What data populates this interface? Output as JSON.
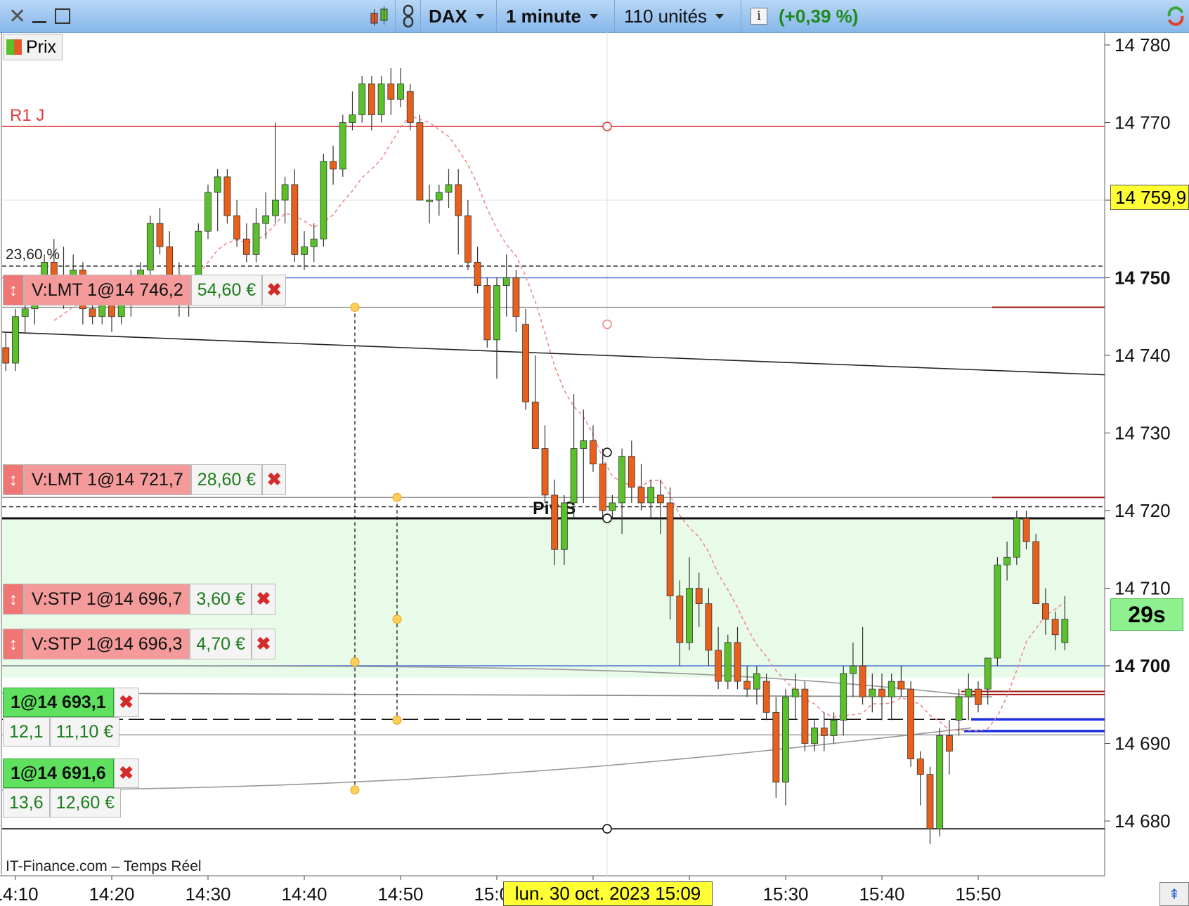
{
  "toolbar": {
    "instrument": "DAX",
    "interval": "1 minute",
    "units": "110 unités",
    "change": "(+0,39 %)",
    "colors": {
      "change": "#1f8a1f"
    }
  },
  "legend": {
    "label": "Prix"
  },
  "watermark": "IT-Finance.com – Temps Réel",
  "timer": "29s",
  "last_price_label": "14 759,9",
  "cursor_date": "lun. 30 oct. 2023 15:09",
  "orders": [
    {
      "label": "V:LMT  1@14 746,2",
      "pnl": "54,60 €"
    },
    {
      "label": "V:LMT  1@14 721,7",
      "pnl": "28,60 €"
    },
    {
      "label": "V:STP  1@14 696,7",
      "pnl": "3,60 €"
    },
    {
      "label": "V:STP  1@14 696,3",
      "pnl": "4,70 €"
    }
  ],
  "positions": [
    {
      "label": "1@14 693,1",
      "points": "12,1",
      "pnl": "11,10 €"
    },
    {
      "label": "1@14 691,6",
      "points": "13,6",
      "pnl": "12,60 €"
    }
  ],
  "chart_data": {
    "type": "candlestick",
    "y_ticks": [
      14680,
      14690,
      14700,
      14710,
      14720,
      14730,
      14740,
      14750,
      14760,
      14770,
      14780
    ],
    "y_tick_labels": [
      "14 680",
      "14 690",
      "14 700",
      "14 710",
      "14 720",
      "14 730",
      "14 740",
      "14 750",
      "14 760",
      "14 770",
      "14 780"
    ],
    "y_bold_ticks": [
      "14 750",
      "14 700"
    ],
    "ylim": [
      14673,
      14782
    ],
    "x_ticks": [
      "14:10",
      "14:20",
      "14:30",
      "14:40",
      "14:50",
      "15:00",
      "15:10",
      "15:20",
      "15:30",
      "15:40",
      "15:50"
    ],
    "levels": {
      "R1 J": 14769.5,
      "23,60 %": 14751.5,
      "38,20 %": 14720.5,
      "50,00 %": 14696.5,
      "Piv S": 14719,
      "S1 J": 14679
    },
    "candles": [
      {
        "t": "14:05",
        "o": 14743,
        "h": 14745,
        "l": 14738,
        "c": 14740
      },
      {
        "t": "14:06",
        "o": 14740,
        "h": 14742,
        "l": 14738,
        "c": 14741
      },
      {
        "t": "14:07",
        "o": 14741,
        "h": 14744,
        "l": 14739,
        "c": 14742
      },
      {
        "t": "14:08",
        "o": 14742,
        "h": 14745,
        "l": 14740,
        "c": 14741
      },
      {
        "t": "14:09",
        "o": 14741,
        "h": 14743,
        "l": 14738,
        "c": 14739
      },
      {
        "t": "14:10",
        "o": 14739,
        "h": 14746,
        "l": 14738,
        "c": 14745
      },
      {
        "t": "14:11",
        "o": 14745,
        "h": 14748,
        "l": 14743,
        "c": 14746
      },
      {
        "t": "14:12",
        "o": 14746,
        "h": 14750,
        "l": 14744,
        "c": 14749
      },
      {
        "t": "14:13",
        "o": 14749,
        "h": 14753,
        "l": 14747,
        "c": 14752
      },
      {
        "t": "14:14",
        "o": 14752,
        "h": 14755,
        "l": 14749,
        "c": 14750
      },
      {
        "t": "14:15",
        "o": 14750,
        "h": 14754,
        "l": 14746,
        "c": 14748
      },
      {
        "t": "14:16",
        "o": 14748,
        "h": 14753,
        "l": 14747,
        "c": 14751
      },
      {
        "t": "14:17",
        "o": 14751,
        "h": 14752,
        "l": 14744,
        "c": 14746
      },
      {
        "t": "14:18",
        "o": 14746,
        "h": 14748,
        "l": 14744,
        "c": 14745
      },
      {
        "t": "14:19",
        "o": 14745,
        "h": 14748,
        "l": 14744,
        "c": 14747
      },
      {
        "t": "14:20",
        "o": 14747,
        "h": 14749,
        "l": 14743,
        "c": 14745
      },
      {
        "t": "14:21",
        "o": 14745,
        "h": 14748,
        "l": 14744,
        "c": 14747
      },
      {
        "t": "14:22",
        "o": 14747,
        "h": 14751,
        "l": 14745,
        "c": 14749
      },
      {
        "t": "14:23",
        "o": 14749,
        "h": 14752,
        "l": 14747,
        "c": 14751
      },
      {
        "t": "14:24",
        "o": 14751,
        "h": 14758,
        "l": 14750,
        "c": 14757
      },
      {
        "t": "14:25",
        "o": 14757,
        "h": 14759,
        "l": 14753,
        "c": 14754
      },
      {
        "t": "14:26",
        "o": 14754,
        "h": 14756,
        "l": 14749,
        "c": 14750
      },
      {
        "t": "14:27",
        "o": 14750,
        "h": 14752,
        "l": 14745,
        "c": 14747
      },
      {
        "t": "14:28",
        "o": 14747,
        "h": 14749,
        "l": 14745,
        "c": 14748
      },
      {
        "t": "14:29",
        "o": 14748,
        "h": 14757,
        "l": 14747,
        "c": 14756
      },
      {
        "t": "14:30",
        "o": 14756,
        "h": 14762,
        "l": 14755,
        "c": 14761
      },
      {
        "t": "14:31",
        "o": 14761,
        "h": 14764,
        "l": 14756,
        "c": 14763
      },
      {
        "t": "14:32",
        "o": 14763,
        "h": 14764,
        "l": 14757,
        "c": 14758
      },
      {
        "t": "14:33",
        "o": 14758,
        "h": 14760,
        "l": 14754,
        "c": 14755
      },
      {
        "t": "14:34",
        "o": 14755,
        "h": 14757,
        "l": 14752,
        "c": 14753
      },
      {
        "t": "14:35",
        "o": 14753,
        "h": 14759,
        "l": 14752,
        "c": 14757
      },
      {
        "t": "14:36",
        "o": 14757,
        "h": 14761,
        "l": 14755,
        "c": 14758
      },
      {
        "t": "14:37",
        "o": 14758,
        "h": 14770,
        "l": 14757,
        "c": 14760
      },
      {
        "t": "14:38",
        "o": 14760,
        "h": 14763,
        "l": 14757,
        "c": 14762
      },
      {
        "t": "14:39",
        "o": 14762,
        "h": 14764,
        "l": 14752,
        "c": 14753
      },
      {
        "t": "14:40",
        "o": 14753,
        "h": 14756,
        "l": 14751,
        "c": 14754
      },
      {
        "t": "14:41",
        "o": 14754,
        "h": 14757,
        "l": 14752,
        "c": 14755
      },
      {
        "t": "14:42",
        "o": 14755,
        "h": 14766,
        "l": 14754,
        "c": 14765
      },
      {
        "t": "14:43",
        "o": 14765,
        "h": 14767,
        "l": 14762,
        "c": 14764
      },
      {
        "t": "14:44",
        "o": 14764,
        "h": 14771,
        "l": 14763,
        "c": 14770
      },
      {
        "t": "14:45",
        "o": 14770,
        "h": 14774,
        "l": 14769,
        "c": 14771
      },
      {
        "t": "14:46",
        "o": 14771,
        "h": 14776,
        "l": 14770,
        "c": 14775
      },
      {
        "t": "14:47",
        "o": 14775,
        "h": 14776,
        "l": 14769,
        "c": 14771
      },
      {
        "t": "14:48",
        "o": 14771,
        "h": 14776,
        "l": 14770,
        "c": 14775
      },
      {
        "t": "14:49",
        "o": 14775,
        "h": 14777,
        "l": 14771,
        "c": 14773
      },
      {
        "t": "14:50",
        "o": 14773,
        "h": 14777,
        "l": 14772,
        "c": 14775
      },
      {
        "t": "14:51",
        "o": 14774,
        "h": 14775,
        "l": 14769,
        "c": 14770
      },
      {
        "t": "14:52",
        "o": 14770,
        "h": 14771,
        "l": 14760,
        "c": 14760
      },
      {
        "t": "14:53",
        "o": 14760,
        "h": 14762,
        "l": 14757,
        "c": 14760
      },
      {
        "t": "14:54",
        "o": 14760,
        "h": 14762,
        "l": 14758,
        "c": 14761
      },
      {
        "t": "14:55",
        "o": 14761,
        "h": 14764,
        "l": 14759,
        "c": 14762
      },
      {
        "t": "14:56",
        "o": 14762,
        "h": 14764,
        "l": 14753,
        "c": 14758
      },
      {
        "t": "14:57",
        "o": 14758,
        "h": 14760,
        "l": 14751,
        "c": 14752
      },
      {
        "t": "14:58",
        "o": 14752,
        "h": 14754,
        "l": 14748,
        "c": 14749
      },
      {
        "t": "14:59",
        "o": 14749,
        "h": 14750,
        "l": 14741,
        "c": 14742
      },
      {
        "t": "15:00",
        "o": 14742,
        "h": 14750,
        "l": 14737,
        "c": 14749
      },
      {
        "t": "15:01",
        "o": 14749,
        "h": 14753,
        "l": 14745,
        "c": 14750
      },
      {
        "t": "15:02",
        "o": 14750,
        "h": 14751,
        "l": 14743,
        "c": 14745
      },
      {
        "t": "15:03",
        "o": 14744,
        "h": 14746,
        "l": 14733,
        "c": 14734
      },
      {
        "t": "15:04",
        "o": 14734,
        "h": 14740,
        "l": 14729,
        "c": 14728
      },
      {
        "t": "15:05",
        "o": 14728,
        "h": 14731,
        "l": 14721,
        "c": 14722
      },
      {
        "t": "15:06",
        "o": 14722,
        "h": 14724,
        "l": 14713,
        "c": 14715
      },
      {
        "t": "15:07",
        "o": 14715,
        "h": 14722,
        "l": 14713,
        "c": 14721
      },
      {
        "t": "15:08",
        "o": 14721,
        "h": 14735,
        "l": 14719,
        "c": 14728
      },
      {
        "t": "15:09",
        "o": 14728,
        "h": 14733,
        "l": 14721,
        "c": 14729
      },
      {
        "t": "15:10",
        "o": 14729,
        "h": 14731,
        "l": 14725,
        "c": 14726
      },
      {
        "t": "15:11",
        "o": 14726,
        "h": 14728,
        "l": 14719,
        "c": 14720
      },
      {
        "t": "15:12",
        "o": 14720,
        "h": 14722,
        "l": 14719,
        "c": 14721
      },
      {
        "t": "15:13",
        "o": 14721,
        "h": 14728,
        "l": 14717,
        "c": 14727
      },
      {
        "t": "15:14",
        "o": 14727,
        "h": 14729,
        "l": 14721,
        "c": 14723
      },
      {
        "t": "15:15",
        "o": 14723,
        "h": 14726,
        "l": 14720,
        "c": 14721
      },
      {
        "t": "15:16",
        "o": 14721,
        "h": 14724,
        "l": 14719,
        "c": 14723
      },
      {
        "t": "15:17",
        "o": 14722,
        "h": 14724,
        "l": 14717,
        "c": 14721
      },
      {
        "t": "15:18",
        "o": 14721,
        "h": 14723,
        "l": 14706,
        "c": 14709
      },
      {
        "t": "15:19",
        "o": 14709,
        "h": 14711,
        "l": 14700,
        "c": 14703
      },
      {
        "t": "15:20",
        "o": 14703,
        "h": 14714,
        "l": 14702,
        "c": 14710
      },
      {
        "t": "15:21",
        "o": 14710,
        "h": 14712,
        "l": 14705,
        "c": 14708
      },
      {
        "t": "15:22",
        "o": 14708,
        "h": 14710,
        "l": 14700,
        "c": 14702
      },
      {
        "t": "15:23",
        "o": 14702,
        "h": 14705,
        "l": 14697,
        "c": 14698
      },
      {
        "t": "15:24",
        "o": 14698,
        "h": 14704,
        "l": 14697,
        "c": 14703
      },
      {
        "t": "15:25",
        "o": 14703,
        "h": 14705,
        "l": 14697,
        "c": 14698
      },
      {
        "t": "15:26",
        "o": 14698,
        "h": 14700,
        "l": 14696,
        "c": 14697
      },
      {
        "t": "15:27",
        "o": 14697,
        "h": 14700,
        "l": 14695,
        "c": 14699
      },
      {
        "t": "15:28",
        "o": 14698,
        "h": 14699,
        "l": 14693,
        "c": 14694
      },
      {
        "t": "15:29",
        "o": 14694,
        "h": 14696,
        "l": 14683,
        "c": 14685
      },
      {
        "t": "15:30",
        "o": 14685,
        "h": 14697,
        "l": 14682,
        "c": 14696
      },
      {
        "t": "15:31",
        "o": 14696,
        "h": 14699,
        "l": 14693,
        "c": 14697
      },
      {
        "t": "15:32",
        "o": 14697,
        "h": 14698,
        "l": 14689,
        "c": 14690
      },
      {
        "t": "15:33",
        "o": 14690,
        "h": 14693,
        "l": 14689,
        "c": 14692
      },
      {
        "t": "15:34",
        "o": 14692,
        "h": 14694,
        "l": 14689,
        "c": 14691
      },
      {
        "t": "15:35",
        "o": 14691,
        "h": 14694,
        "l": 14690,
        "c": 14693
      },
      {
        "t": "15:36",
        "o": 14693,
        "h": 14700,
        "l": 14691,
        "c": 14699
      },
      {
        "t": "15:37",
        "o": 14699,
        "h": 14703,
        "l": 14696,
        "c": 14700
      },
      {
        "t": "15:38",
        "o": 14700,
        "h": 14705,
        "l": 14695,
        "c": 14696
      },
      {
        "t": "15:39",
        "o": 14696,
        "h": 14699,
        "l": 14694,
        "c": 14697
      },
      {
        "t": "15:40",
        "o": 14697,
        "h": 14699,
        "l": 14693,
        "c": 14696
      },
      {
        "t": "15:41",
        "o": 14696,
        "h": 14699,
        "l": 14693,
        "c": 14698
      },
      {
        "t": "15:42",
        "o": 14698,
        "h": 14700,
        "l": 14696,
        "c": 14697
      },
      {
        "t": "15:43",
        "o": 14697,
        "h": 14698,
        "l": 14687,
        "c": 14688
      },
      {
        "t": "15:44",
        "o": 14688,
        "h": 14689,
        "l": 14682,
        "c": 14686
      },
      {
        "t": "15:45",
        "o": 14686,
        "h": 14687,
        "l": 14677,
        "c": 14679
      },
      {
        "t": "15:46",
        "o": 14679,
        "h": 14692,
        "l": 14678,
        "c": 14691
      },
      {
        "t": "15:47",
        "o": 14691,
        "h": 14693,
        "l": 14686,
        "c": 14689
      },
      {
        "t": "15:48",
        "o": 14693,
        "h": 14697,
        "l": 14691,
        "c": 14696
      },
      {
        "t": "15:49",
        "o": 14696,
        "h": 14699,
        "l": 14693,
        "c": 14697
      },
      {
        "t": "15:50",
        "o": 14697,
        "h": 14698,
        "l": 14694,
        "c": 14695
      },
      {
        "t": "15:51",
        "o": 14697,
        "h": 14701,
        "l": 14695,
        "c": 14701
      },
      {
        "t": "15:52",
        "o": 14701,
        "h": 14714,
        "l": 14700,
        "c": 14713
      },
      {
        "t": "15:53",
        "o": 14713,
        "h": 14716,
        "l": 14711,
        "c": 14714
      },
      {
        "t": "15:54",
        "o": 14714,
        "h": 14720,
        "l": 14713,
        "c": 14719
      },
      {
        "t": "15:55",
        "o": 14719,
        "h": 14720,
        "l": 14715,
        "c": 14716
      },
      {
        "t": "15:56",
        "o": 14716,
        "h": 14717,
        "l": 14708,
        "c": 14708
      },
      {
        "t": "15:57",
        "o": 14708,
        "h": 14710,
        "l": 14704,
        "c": 14706
      },
      {
        "t": "15:58",
        "o": 14706,
        "h": 14707,
        "l": 14702,
        "c": 14704
      },
      {
        "t": "15:59",
        "o": 14703,
        "h": 14709,
        "l": 14702,
        "c": 14706
      }
    ]
  }
}
